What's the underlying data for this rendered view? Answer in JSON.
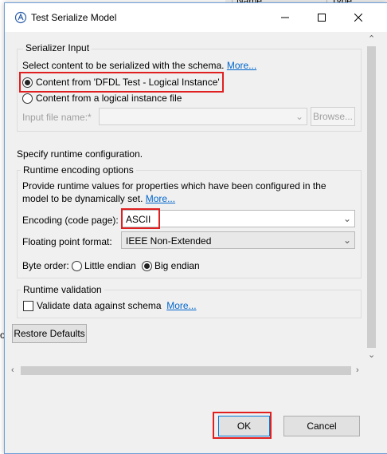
{
  "background": {
    "col_name": "Name",
    "col_type": "Type",
    "stub_text": "od"
  },
  "window": {
    "title": "Test Serialize Model",
    "icons": {
      "app": "dfdl-app-icon",
      "minimize": "minimize-icon",
      "maximize": "maximize-icon",
      "close": "close-icon"
    }
  },
  "serializer_input": {
    "group_title": "Serializer Input",
    "description": "Select content to be serialized with the schema.",
    "more_link": "More...",
    "option_instance": "Content from 'DFDL Test - Logical Instance'",
    "option_file": "Content from a logical instance file",
    "selected": "instance",
    "file_label": "Input file name:*",
    "file_value": "",
    "browse_label": "Browse..."
  },
  "runtime": {
    "heading": "Specify runtime configuration.",
    "encoding_group_title": "Runtime encoding options",
    "encoding_desc_line1": "Provide runtime values for properties which have been configured in the",
    "encoding_desc_line2": "model to be dynamically set.",
    "more_link": "More...",
    "encoding_label": "Encoding (code page):",
    "encoding_value": "ASCII",
    "float_label": "Floating point format:",
    "float_value": "IEEE Non-Extended",
    "byte_order_label": "Byte order:",
    "byte_little": "Little endian",
    "byte_big": "Big endian",
    "byte_selected": "big"
  },
  "validation": {
    "group_title": "Runtime validation",
    "checkbox_label": "Validate data against schema",
    "more_link": "More...",
    "checked": false
  },
  "buttons": {
    "restore_defaults": "Restore Defaults",
    "ok": "OK",
    "cancel": "Cancel"
  },
  "colors": {
    "highlight": "#e02020",
    "link": "#0066cc",
    "dialog_bg": "#f0f0f0",
    "ok_border": "#0078d7"
  }
}
